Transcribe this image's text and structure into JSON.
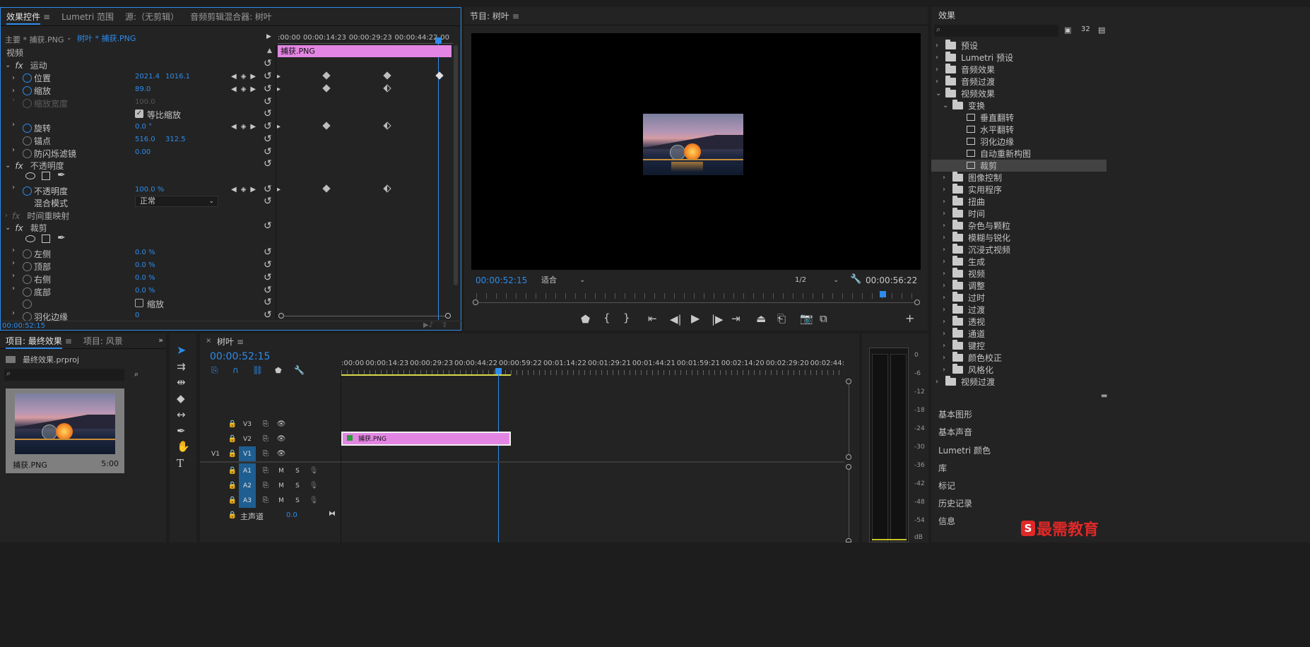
{
  "effect_controls": {
    "tabs": [
      "效果控件",
      "Lumetri 范围",
      "源:（无剪辑）",
      "音频剪辑混合器: 树叶"
    ],
    "master_label": "主要 * 捕获.PNG",
    "clip_label": "树叶 * 捕获.PNG",
    "ruler": [
      ":00:00",
      "00:00:14:23",
      "00:00:29:23",
      "00:00:44:22",
      "00"
    ],
    "clip_bar": "捕获.PNG",
    "video_label": "视频",
    "motion": "运动",
    "position": {
      "label": "位置",
      "x": "2021.4",
      "y": "1016.1"
    },
    "scale": {
      "label": "缩放",
      "value": "89.0"
    },
    "scale_width": {
      "label": "缩放宽度",
      "value": "100.0"
    },
    "uniform_scale": "等比缩放",
    "rotation": {
      "label": "旋转",
      "value": "0.0 °"
    },
    "anchor": {
      "label": "锚点",
      "x": "516.0",
      "y": "312.5"
    },
    "antiflicker": {
      "label": "防闪烁滤镜",
      "value": "0.00"
    },
    "opacity_section": "不透明度",
    "opacity": {
      "label": "不透明度",
      "value": "100.0 %"
    },
    "blend_mode": {
      "label": "混合模式",
      "value": "正常"
    },
    "time_remap": "时间重映射",
    "crop_section": "裁剪",
    "crop_left": {
      "label": "左侧",
      "value": "0.0 %"
    },
    "crop_top": {
      "label": "顶部",
      "value": "0.0 %"
    },
    "crop_right": {
      "label": "右侧",
      "value": "0.0 %"
    },
    "crop_bottom": {
      "label": "底部",
      "value": "0.0 %"
    },
    "crop_zoom": "缩放",
    "feather": {
      "label": "羽化边缘",
      "value": "0"
    },
    "timecode": "00:00:52:15"
  },
  "program_monitor": {
    "title": "节目: 树叶",
    "timecode": "00:00:52:15",
    "fit": "适合",
    "resolution": "1/2",
    "duration": "00:00:56:22"
  },
  "effects": {
    "title": "效果",
    "items": [
      {
        "label": "预设",
        "indent": 0,
        "type": "folder",
        "open": false
      },
      {
        "label": "Lumetri 预设",
        "indent": 0,
        "type": "folder",
        "open": false
      },
      {
        "label": "音频效果",
        "indent": 0,
        "type": "folder",
        "open": false
      },
      {
        "label": "音频过渡",
        "indent": 0,
        "type": "folder",
        "open": false
      },
      {
        "label": "视频效果",
        "indent": 0,
        "type": "folder",
        "open": true
      },
      {
        "label": "变换",
        "indent": 1,
        "type": "folder",
        "open": true
      },
      {
        "label": "垂直翻转",
        "indent": 2,
        "type": "effect"
      },
      {
        "label": "水平翻转",
        "indent": 2,
        "type": "effect"
      },
      {
        "label": "羽化边缘",
        "indent": 2,
        "type": "effect"
      },
      {
        "label": "自动重新构图",
        "indent": 2,
        "type": "effect"
      },
      {
        "label": "裁剪",
        "indent": 2,
        "type": "effect",
        "selected": true
      },
      {
        "label": "图像控制",
        "indent": 1,
        "type": "folder",
        "open": false
      },
      {
        "label": "实用程序",
        "indent": 1,
        "type": "folder",
        "open": false
      },
      {
        "label": "扭曲",
        "indent": 1,
        "type": "folder",
        "open": false
      },
      {
        "label": "时间",
        "indent": 1,
        "type": "folder",
        "open": false
      },
      {
        "label": "杂色与颗粒",
        "indent": 1,
        "type": "folder",
        "open": false
      },
      {
        "label": "模糊与锐化",
        "indent": 1,
        "type": "folder",
        "open": false
      },
      {
        "label": "沉浸式视频",
        "indent": 1,
        "type": "folder",
        "open": false
      },
      {
        "label": "生成",
        "indent": 1,
        "type": "folder",
        "open": false
      },
      {
        "label": "视频",
        "indent": 1,
        "type": "folder",
        "open": false
      },
      {
        "label": "调整",
        "indent": 1,
        "type": "folder",
        "open": false
      },
      {
        "label": "过时",
        "indent": 1,
        "type": "folder",
        "open": false
      },
      {
        "label": "过渡",
        "indent": 1,
        "type": "folder",
        "open": false
      },
      {
        "label": "透视",
        "indent": 1,
        "type": "folder",
        "open": false
      },
      {
        "label": "通道",
        "indent": 1,
        "type": "folder",
        "open": false
      },
      {
        "label": "键控",
        "indent": 1,
        "type": "folder",
        "open": false
      },
      {
        "label": "颜色校正",
        "indent": 1,
        "type": "folder",
        "open": false
      },
      {
        "label": "风格化",
        "indent": 1,
        "type": "folder",
        "open": false
      },
      {
        "label": "视频过渡",
        "indent": 0,
        "type": "folder",
        "open": false
      }
    ],
    "sections": [
      "基本图形",
      "基本声音",
      "Lumetri 颜色",
      "库",
      "标记",
      "历史记录",
      "信息"
    ]
  },
  "project": {
    "tabs": [
      "项目: 最终效果",
      "项目: 风景"
    ],
    "file": "最终效果.prproj",
    "clip_name": "捕获.PNG",
    "clip_duration": "5:00"
  },
  "timeline": {
    "title": "树叶",
    "timecode": "00:00:52:15",
    "ruler": [
      ":00:00",
      "00:00:14:23",
      "00:00:29:23",
      "00:00:44:22",
      "00:00:59:22",
      "00:01:14:22",
      "00:01:29:21",
      "00:01:44:21",
      "00:01:59:21",
      "00:02:14:20",
      "00:02:29:20",
      "00:02:44:"
    ],
    "tracks_video": [
      "V3",
      "V2",
      "V1"
    ],
    "source_patch": "V1",
    "tracks_audio": [
      "A1",
      "A2",
      "A3"
    ],
    "clip": "捕获.PNG",
    "mute": "M",
    "solo": "S",
    "master": {
      "label": "主声道",
      "value": "0.0"
    }
  },
  "meter": {
    "scale": [
      "0",
      "-6",
      "-12",
      "-18",
      "-24",
      "-30",
      "-36",
      "-42",
      "-48",
      "-54",
      "dB"
    ]
  },
  "watermark": "最需教育"
}
